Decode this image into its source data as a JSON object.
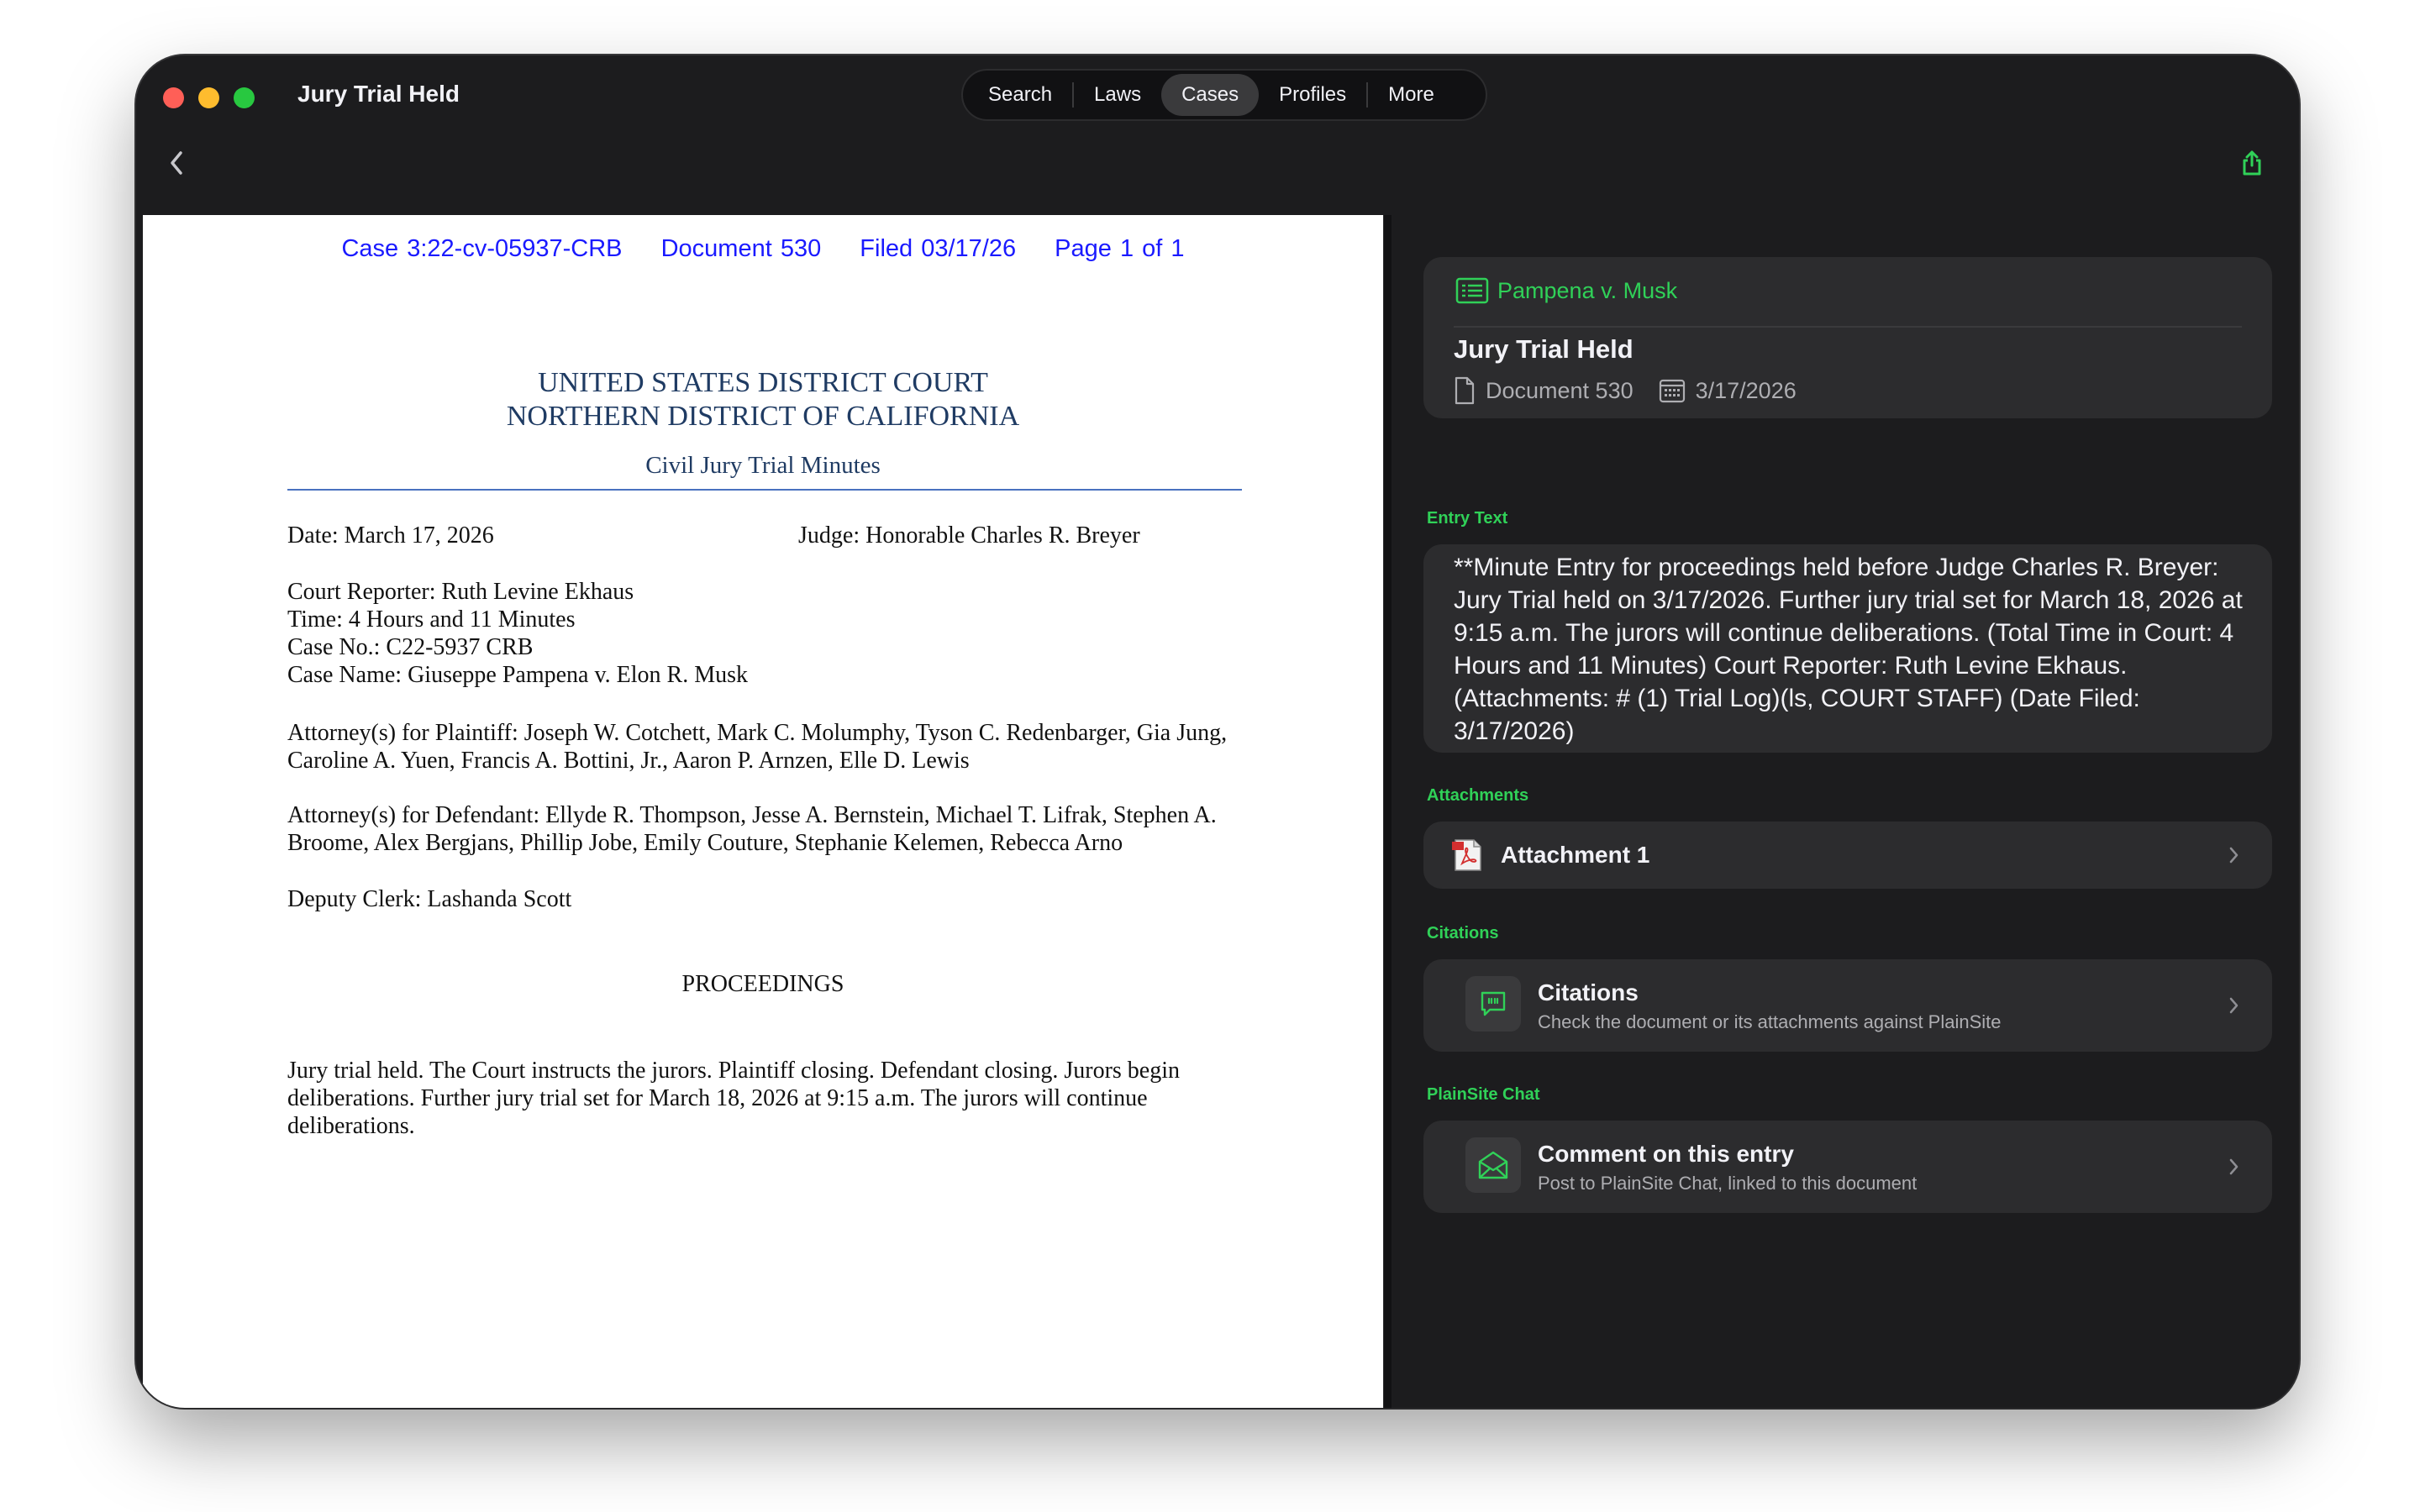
{
  "window": {
    "title": "Jury Trial Held"
  },
  "nav": {
    "tabs": [
      "Search",
      "Laws",
      "Cases",
      "Profiles",
      "More"
    ],
    "active": "Cases"
  },
  "document": {
    "header": {
      "case": "Case 3:22-cv-05937-CRB",
      "document": "Document 530",
      "filed": "Filed 03/17/26",
      "page": "Page 1 of 1"
    },
    "court_line1": "UNITED STATES DISTRICT COURT",
    "court_line2": "NORTHERN DISTRICT OF CALIFORNIA",
    "minutes_title": "Civil Jury Trial Minutes",
    "date": "Date: March 17, 2026",
    "judge": "Judge: Honorable Charles R. Breyer",
    "reporter": "Court Reporter: Ruth Levine Ekhaus",
    "time": "Time: 4 Hours and 11 Minutes",
    "case_no": "Case No.: C22-5937 CRB",
    "case_name": "Case Name: Giuseppe Pampena v. Elon R. Musk",
    "plaintiff_attorneys": "Attorney(s) for Plaintiff: Joseph W. Cotchett, Mark C. Molumphy, Tyson C. Redenbarger, Gia Jung, Caroline A. Yuen, Francis A. Bottini, Jr., Aaron P. Arnzen, Elle D. Lewis",
    "defendant_attorneys": "Attorney(s) for Defendant: Ellyde R. Thompson, Jesse A. Bernstein, Michael T. Lifrak, Stephen A. Broome, Alex Bergjans, Phillip Jobe, Emily Couture, Stephanie Kelemen, Rebecca Arno",
    "deputy_clerk": "Deputy Clerk: Lashanda Scott",
    "proceedings_heading": "PROCEEDINGS",
    "proceedings_text": "Jury trial held. The Court instructs the jurors.  Plaintiff closing. Defendant closing. Jurors begin deliberations. Further jury trial set for March 18, 2026 at 9:15 a.m.  The jurors will continue deliberations."
  },
  "side": {
    "case_name": "Pampena v. Musk",
    "entry_title": "Jury Trial Held",
    "doc_number": "Document 530",
    "date": "3/17/2026",
    "entry_text_label": "Entry Text",
    "entry_text": "**Minute Entry for proceedings held before Judge Charles R. Breyer: Jury Trial held on 3/17/2026. Further jury trial set for March 18, 2026 at 9:15 a.m. The jurors will continue deliberations. (Total Time in Court: 4 Hours and 11 Minutes) Court Reporter: Ruth Levine Ekhaus. (Attachments: # (1) Trial Log)(ls, COURT STAFF) (Date Filed: 3/17/2026)",
    "attachments_label": "Attachments",
    "attachment_1": "Attachment 1",
    "citations_label": "Citations",
    "citations_title": "Citations",
    "citations_sub": "Check the document or its attachments against PlainSite",
    "chat_label": "PlainSite Chat",
    "chat_title": "Comment on this entry",
    "chat_sub": "Post to PlainSite Chat, linked to this document"
  },
  "colors": {
    "accent": "#30d158",
    "doc_header_blue": "#1a1aff",
    "court_title": "#1f3b63"
  }
}
